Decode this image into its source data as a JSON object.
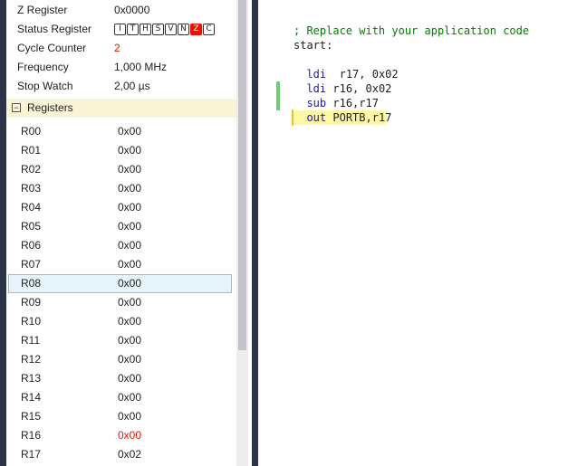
{
  "processor": {
    "properties": [
      {
        "label": "Z Register",
        "value": "0x0000"
      },
      {
        "label": "Status Register",
        "value": ""
      },
      {
        "label": "Cycle Counter",
        "value": "2"
      },
      {
        "label": "Frequency",
        "value": "1,000 MHz"
      },
      {
        "label": "Stop Watch",
        "value": "2,00 µs"
      }
    ],
    "status_flags": [
      {
        "letter": "I",
        "set": false
      },
      {
        "letter": "T",
        "set": false
      },
      {
        "letter": "H",
        "set": false
      },
      {
        "letter": "S",
        "set": false
      },
      {
        "letter": "V",
        "set": false
      },
      {
        "letter": "N",
        "set": false
      },
      {
        "letter": "Z",
        "set": true
      },
      {
        "letter": "C",
        "set": false
      }
    ],
    "cycle_counter_color": "#e51400",
    "registers_section": {
      "label": "Registers",
      "expander": "−",
      "expanded": true
    },
    "registers": [
      {
        "name": "R00",
        "value": "0x00"
      },
      {
        "name": "R01",
        "value": "0x00"
      },
      {
        "name": "R02",
        "value": "0x00"
      },
      {
        "name": "R03",
        "value": "0x00"
      },
      {
        "name": "R04",
        "value": "0x00"
      },
      {
        "name": "R05",
        "value": "0x00"
      },
      {
        "name": "R06",
        "value": "0x00"
      },
      {
        "name": "R07",
        "value": "0x00"
      },
      {
        "name": "R08",
        "value": "0x00",
        "selected": true
      },
      {
        "name": "R09",
        "value": "0x00"
      },
      {
        "name": "R10",
        "value": "0x00"
      },
      {
        "name": "R11",
        "value": "0x00"
      },
      {
        "name": "R12",
        "value": "0x00"
      },
      {
        "name": "R13",
        "value": "0x00"
      },
      {
        "name": "R14",
        "value": "0x00"
      },
      {
        "name": "R15",
        "value": "0x00"
      },
      {
        "name": "R16",
        "value": "0x00",
        "changed": true
      },
      {
        "name": "R17",
        "value": "0x02"
      }
    ],
    "changed_value_color": "#e51400"
  },
  "editor": {
    "lines": [
      {
        "text": "; Replace with your application code",
        "kind": "comment"
      },
      {
        "text": "start:",
        "kind": "label"
      },
      {
        "text": "",
        "kind": "blank"
      },
      {
        "text": "  ldi  r17, 0x02",
        "kind": "code",
        "mnemonic": "ldi",
        "operands": "  r17, 0x02"
      },
      {
        "text": "  ldi r16, 0x02",
        "kind": "code",
        "mnemonic": "ldi",
        "operands": " r16, 0x02",
        "changed": true
      },
      {
        "text": "  sub r16,r17",
        "kind": "code",
        "mnemonic": "sub",
        "operands": " r16,r17",
        "changed": true
      },
      {
        "text": "  out PORTB,r17",
        "kind": "code",
        "mnemonic": "out",
        "operands": " PORTB,r17",
        "current": true
      }
    ],
    "current_line_icon": "execution-arrow-icon",
    "colors": {
      "comment": "#008000",
      "keyword": "#1a1aaa",
      "current_line": "#fff7a8",
      "change_marker": "#6fce6f"
    }
  }
}
